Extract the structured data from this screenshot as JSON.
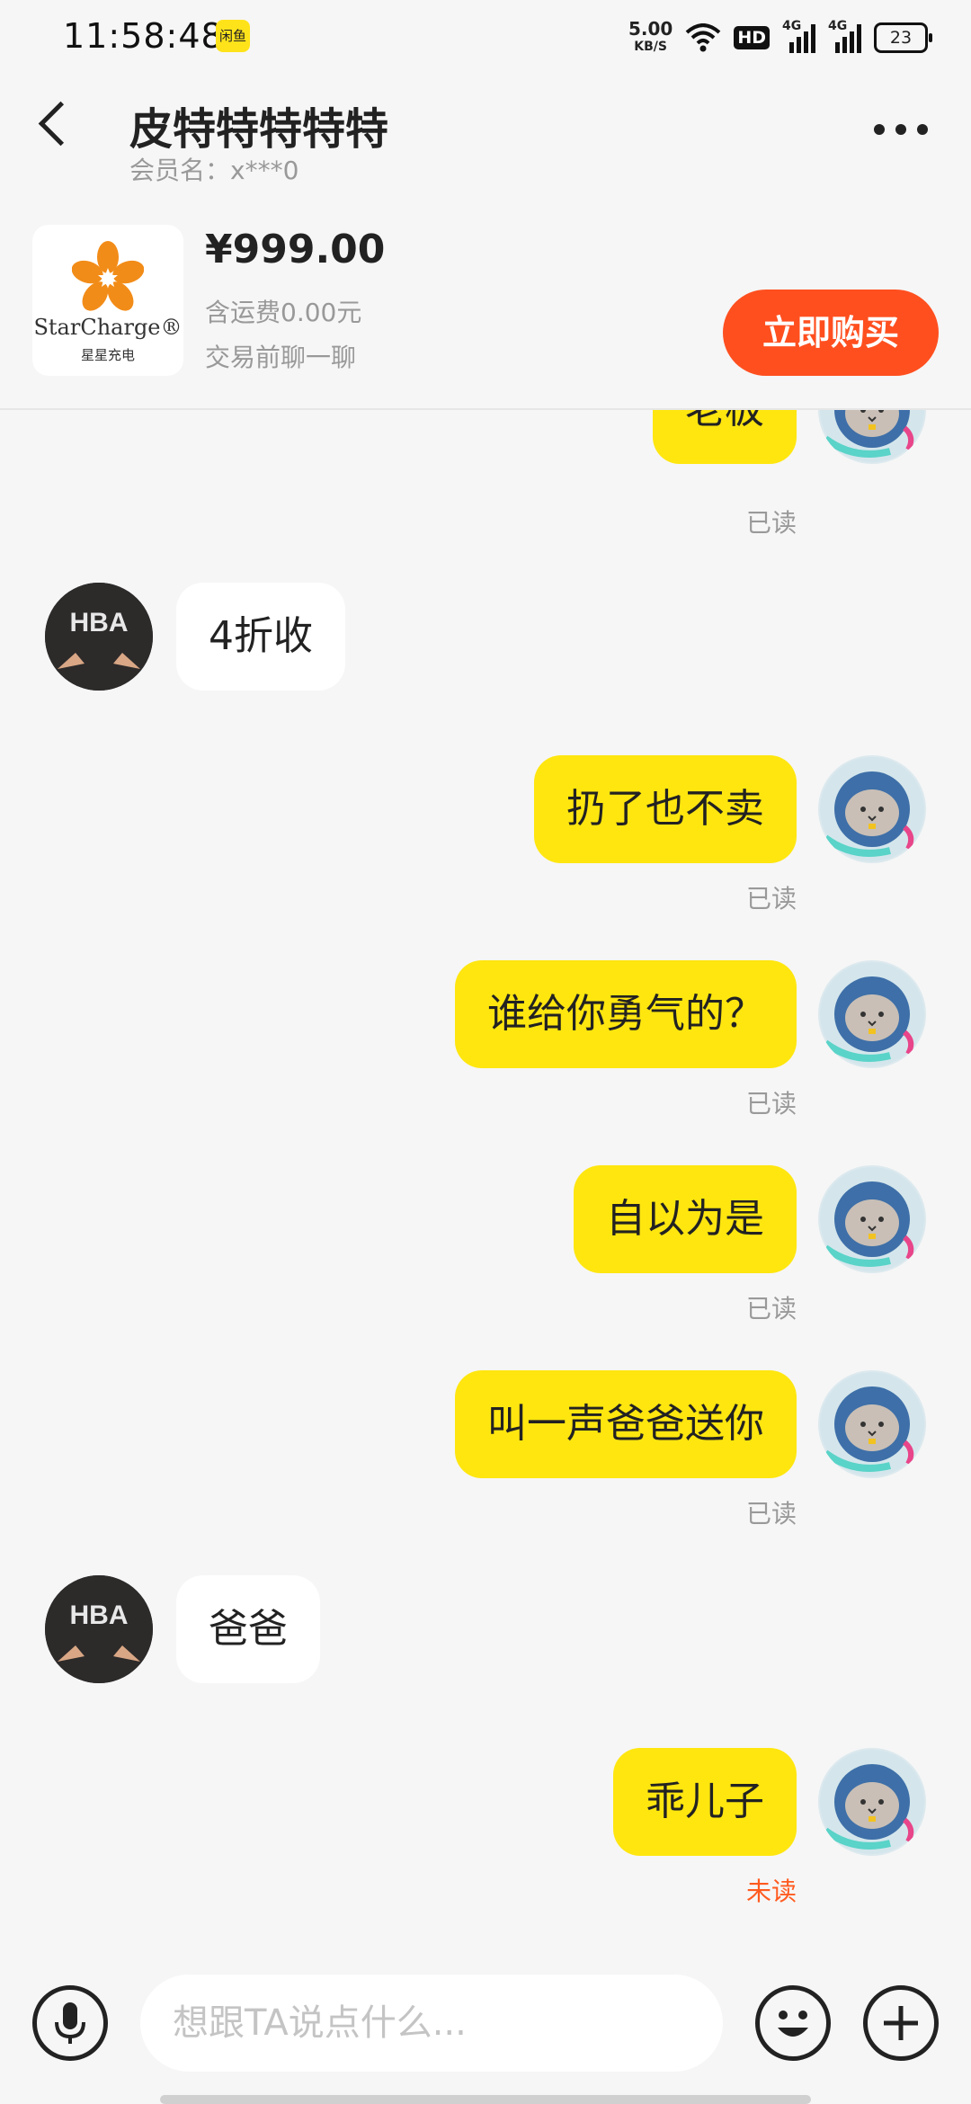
{
  "status_bar": {
    "time": "11:58:48",
    "app_badge": "闲鱼",
    "speed_value": "5.00",
    "speed_unit": "KB/S",
    "hd_label": "HD",
    "network_1": "4G",
    "network_2": "4G",
    "battery": "23"
  },
  "header": {
    "title": "皮特特特特特",
    "member": "会员名：x***0"
  },
  "product": {
    "brand_en": "StarCharge®",
    "brand_cn": "星星充电",
    "price": "¥999.00",
    "shipping": "含运费0.00元",
    "chat_hint": "交易前聊一聊",
    "buy_label": "立即购买"
  },
  "messages": [
    {
      "side": "me",
      "text": "老板",
      "status": "已读"
    },
    {
      "side": "them",
      "text": "4折收"
    },
    {
      "side": "me",
      "text": "扔了也不卖",
      "status": "已读"
    },
    {
      "side": "me",
      "text": "谁给你勇气的？",
      "status": "已读"
    },
    {
      "side": "me",
      "text": "自以为是",
      "status": "已读"
    },
    {
      "side": "me",
      "text": "叫一声爸爸送你",
      "status": "已读"
    },
    {
      "side": "them",
      "text": "爸爸"
    },
    {
      "side": "me",
      "text": "乖儿子",
      "status": "未读"
    }
  ],
  "input": {
    "placeholder": "想跟TA说点什么..."
  },
  "avatar_them_text": "HBA",
  "colors": {
    "accent_yellow": "#ffe60f",
    "buy_orange": "#ff4f1f",
    "unread_orange": "#ff5a1f"
  }
}
